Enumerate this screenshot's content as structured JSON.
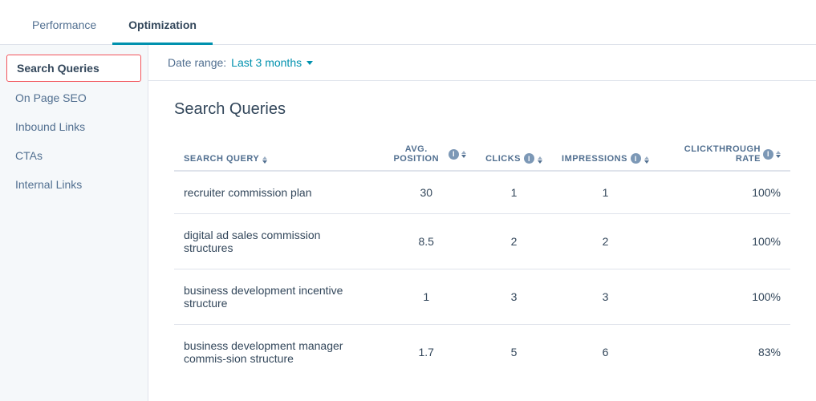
{
  "tabs": [
    {
      "id": "performance",
      "label": "Performance",
      "active": false
    },
    {
      "id": "optimization",
      "label": "Optimization",
      "active": true
    }
  ],
  "sidebar": {
    "items": [
      {
        "id": "search-queries",
        "label": "Search Queries",
        "active": true
      },
      {
        "id": "on-page-seo",
        "label": "On Page SEO",
        "active": false
      },
      {
        "id": "inbound-links",
        "label": "Inbound Links",
        "active": false
      },
      {
        "id": "ctas",
        "label": "CTAs",
        "active": false
      },
      {
        "id": "internal-links",
        "label": "Internal Links",
        "active": false
      }
    ]
  },
  "date_range": {
    "label": "Date range:",
    "value": "Last 3 months"
  },
  "section": {
    "title": "Search Queries",
    "columns": [
      {
        "id": "query",
        "label": "SEARCH QUERY",
        "sortable": true
      },
      {
        "id": "avg-position",
        "label": "AVG. POSITION",
        "info": true,
        "sortable": true
      },
      {
        "id": "clicks",
        "label": "CLICKS",
        "info": true,
        "sortable": true
      },
      {
        "id": "impressions",
        "label": "IMPRESSIONS",
        "info": true,
        "sortable": true
      },
      {
        "id": "ctr",
        "label": "CLICKTHROUGH RATE",
        "info": true,
        "sortable": true
      }
    ],
    "rows": [
      {
        "query": "recruiter commission plan",
        "avg_position": "30",
        "clicks": "1",
        "impressions": "1",
        "ctr": "100%"
      },
      {
        "query": "digital ad sales commission structures",
        "avg_position": "8.5",
        "clicks": "2",
        "impressions": "2",
        "ctr": "100%"
      },
      {
        "query": "business development incentive structure",
        "avg_position": "1",
        "clicks": "3",
        "impressions": "3",
        "ctr": "100%"
      },
      {
        "query": "business development manager commis-sion structure",
        "avg_position": "1.7",
        "clicks": "5",
        "impressions": "6",
        "ctr": "83%"
      }
    ]
  }
}
